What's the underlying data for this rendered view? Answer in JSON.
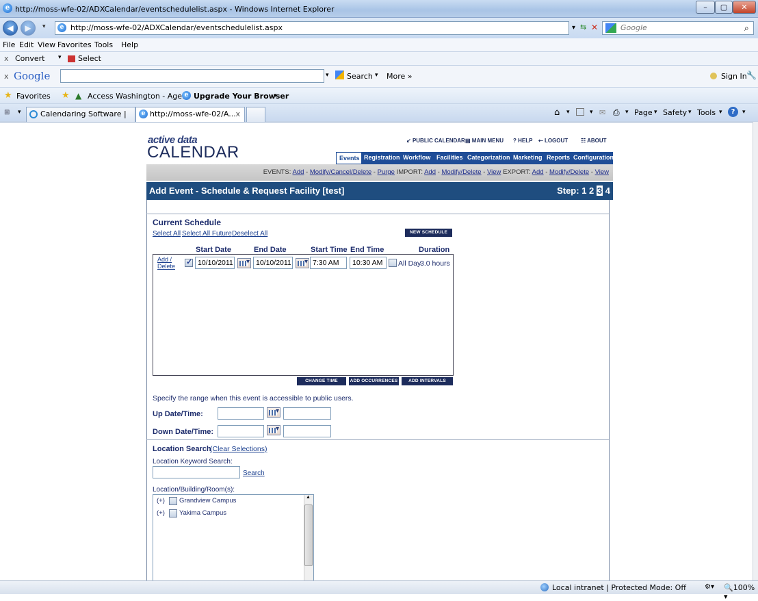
{
  "window": {
    "title": "http://moss-wfe-02/ADXCalendar/eventschedulelist.aspx - Windows Internet Explorer",
    "min": "–",
    "max": "▢",
    "close": "✕"
  },
  "address": {
    "url": "http://moss-wfe-02/ADXCalendar/eventschedulelist.aspx",
    "search_placeholder": "Google"
  },
  "menu": {
    "file": "File",
    "edit": "Edit",
    "view": "View",
    "favorites": "Favorites",
    "tools": "Tools",
    "help": "Help"
  },
  "convertbar": {
    "close": "x",
    "convert": "Convert",
    "select": "Select"
  },
  "googlebar": {
    "close": "x",
    "logo": "Google",
    "search": "Search",
    "more": "More »",
    "signin": "Sign In"
  },
  "favbar": {
    "favorites": "Favorites",
    "item1": "Access Washington - Age...",
    "item2": "Upgrade Your Browser"
  },
  "tabs": {
    "tab1": "Calendaring Software | Act...",
    "tab2": "http://moss-wfe-02/A...",
    "close": "x"
  },
  "cmdbar": {
    "page": "Page",
    "safety": "Safety",
    "tools": "Tools"
  },
  "status": {
    "zone": "Local intranet | Protected Mode: Off",
    "zoom": "100%"
  },
  "app": {
    "logo_small": "active data",
    "logo_big": "CALENDAR",
    "toplinks": [
      "PUBLIC CALENDAR",
      "MAIN MENU",
      "? HELP",
      "LOGOUT",
      "ABOUT"
    ],
    "navtabs": [
      "Events",
      "Registration",
      "Workflow",
      "Facilities",
      "Categorization",
      "Marketing",
      "Reports",
      "Configuration"
    ],
    "sub": {
      "events": "EVENTS:",
      "add": "Add",
      "modify": "Modify/Cancel/Delete",
      "purge": "Purge",
      "import": "IMPORT:",
      "imp_add": "Add",
      "imp_mod": "Modify/Delete",
      "imp_view": "View",
      "export": "EXPORT:",
      "exp_add": "Add",
      "exp_mod": "Modify/Delete",
      "exp_view": "View",
      "sep": "-"
    },
    "header": "Add Event - Schedule & Request Facility [test]",
    "step": {
      "label": "Step:",
      "s1": "1",
      "s2": "2",
      "s3": "3",
      "s4": "4"
    },
    "schedule": {
      "title": "Current Schedule",
      "select_all": "Select All",
      "select_future": "Select All Future",
      "deselect_all": "Deselect All",
      "new_schedule": "NEW SCHEDULE",
      "cols": {
        "start_date": "Start Date",
        "end_date": "End Date",
        "start_time": "Start Time",
        "end_time": "End Time",
        "duration": "Duration"
      },
      "row": {
        "add": "Add /",
        "delete": "Delete",
        "start_date": "10/10/2011",
        "end_date": "10/10/2011",
        "start_time": "7:30 AM",
        "end_time": "10:30 AM",
        "allday": "All Day",
        "duration": "3.0 hours"
      },
      "change_time": "CHANGE TIME",
      "add_occ": "ADD OCCURRENCES",
      "add_int": "ADD INTERVALS"
    },
    "access": {
      "note": "Specify the range when this event is accessible to public users.",
      "up": "Up Date/Time:",
      "down": "Down Date/Time:"
    },
    "location": {
      "title": "Location Search",
      "clear": "(Clear Selections)",
      "kw_label": "Location Keyword Search:",
      "search": "Search",
      "list_label": "Location/Building/Room(s):",
      "items": [
        "Grandview Campus",
        "Yakima Campus"
      ],
      "expand": "(+)"
    }
  }
}
